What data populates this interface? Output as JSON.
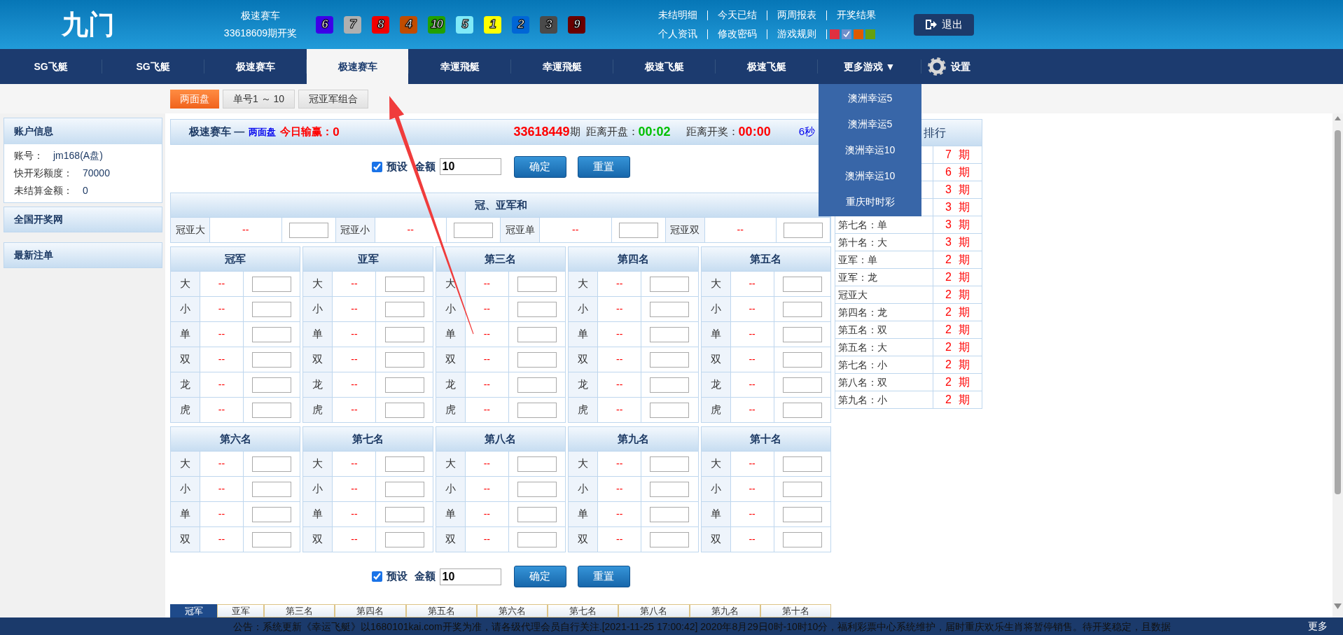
{
  "header": {
    "logo": "九门",
    "game": "极速赛车",
    "draw": "33618609期开奖",
    "balls": [
      {
        "number": "6",
        "color": "#3c00e8"
      },
      {
        "number": "7",
        "color": "#b0b0b0"
      },
      {
        "number": "8",
        "color": "#f00000"
      },
      {
        "number": "4",
        "color": "#c04c00"
      },
      {
        "number": "10",
        "color": "#22a000"
      },
      {
        "number": "5",
        "color": "#80eaf8"
      },
      {
        "number": "1",
        "color": "#ffff00"
      },
      {
        "number": "2",
        "color": "#0066d6"
      },
      {
        "number": "3",
        "color": "#4a4a4a"
      },
      {
        "number": "9",
        "color": "#6a0000"
      }
    ],
    "links_row_1": [
      "未结明细",
      "今天已结",
      "两周报表",
      "开奖结果"
    ],
    "links_row_2": [
      "个人资讯",
      "修改密码",
      "游戏规则"
    ],
    "themes": [
      {
        "color": "#e03040",
        "selected": false
      },
      {
        "color": "#6f8fcc",
        "selected": true
      },
      {
        "color": "#e05a00",
        "selected": false
      },
      {
        "color": "#66a010",
        "selected": false
      }
    ],
    "logout": "退出"
  },
  "nav": {
    "tabs": [
      {
        "label": "SG飞艇",
        "selected": false
      },
      {
        "label": "SG飞艇",
        "selected": false
      },
      {
        "label": "极速赛车",
        "selected": false
      },
      {
        "label": "极速赛车",
        "selected": true
      },
      {
        "label": "幸運飛艇",
        "selected": false
      },
      {
        "label": "幸運飛艇",
        "selected": false
      },
      {
        "label": "极速飞艇",
        "selected": false
      },
      {
        "label": "极速飞艇",
        "selected": false
      }
    ],
    "more": "更多游戏 ▼",
    "settings": "设置",
    "menu": [
      "澳洲幸运5",
      "澳洲幸运5",
      "澳洲幸运10",
      "澳洲幸运10",
      "重庆时时彩"
    ]
  },
  "subtabs": [
    {
      "label": "两面盘",
      "selected": true
    },
    {
      "label": "单号1 ～ 10",
      "selected": false
    },
    {
      "label": "冠亚军组合",
      "selected": false
    }
  ],
  "sidebar": {
    "account_title": "账户信息",
    "account_rows": [
      {
        "label": "账号：",
        "value": "jm168(A盘)"
      },
      {
        "label": "快开彩额度：",
        "value": "70000"
      },
      {
        "label": "未结算金额：",
        "value": "0"
      }
    ],
    "panels": [
      "全国开奖网",
      "最新注单"
    ]
  },
  "bet_header": {
    "game": "极速赛车 —",
    "mode": "两面盘",
    "today_label": "今日输赢：",
    "today_value": "0",
    "period": "33618449",
    "period_suffix": "期",
    "open_label": "距离开盘：",
    "open_time": "00:02",
    "draw_label": "距离开奖：",
    "draw_time": "00:00",
    "refresh": "6秒"
  },
  "presets": [
    {
      "label": "预设",
      "checked": true,
      "amount_label": "金额",
      "amount": "10",
      "confirm": "确定",
      "reset": "重置"
    },
    {
      "label": "预设",
      "checked": true,
      "amount_label": "金额",
      "amount": "10",
      "confirm": "确定",
      "reset": "重置"
    }
  ],
  "sum_section": {
    "title": "冠、亚军和",
    "items": [
      {
        "label": "冠亚大",
        "odds": "--"
      },
      {
        "label": "冠亚小",
        "odds": "--"
      },
      {
        "label": "冠亚单",
        "odds": "--"
      },
      {
        "label": "冠亚双",
        "odds": "--"
      }
    ]
  },
  "grids": [
    {
      "columns": [
        {
          "title": "冠军",
          "rows": [
            {
              "label": "大",
              "odds": "--"
            },
            {
              "label": "小",
              "odds": "--"
            },
            {
              "label": "单",
              "odds": "--"
            },
            {
              "label": "双",
              "odds": "--"
            },
            {
              "label": "龙",
              "odds": "--"
            },
            {
              "label": "虎",
              "odds": "--"
            }
          ]
        },
        {
          "title": "亚军",
          "rows": [
            {
              "label": "大",
              "odds": "--"
            },
            {
              "label": "小",
              "odds": "--"
            },
            {
              "label": "单",
              "odds": "--"
            },
            {
              "label": "双",
              "odds": "--"
            },
            {
              "label": "龙",
              "odds": "--"
            },
            {
              "label": "虎",
              "odds": "--"
            }
          ]
        },
        {
          "title": "第三名",
          "rows": [
            {
              "label": "大",
              "odds": "--"
            },
            {
              "label": "小",
              "odds": "--"
            },
            {
              "label": "单",
              "odds": "--"
            },
            {
              "label": "双",
              "odds": "--"
            },
            {
              "label": "龙",
              "odds": "--"
            },
            {
              "label": "虎",
              "odds": "--"
            }
          ]
        },
        {
          "title": "第四名",
          "rows": [
            {
              "label": "大",
              "odds": "--"
            },
            {
              "label": "小",
              "odds": "--"
            },
            {
              "label": "单",
              "odds": "--"
            },
            {
              "label": "双",
              "odds": "--"
            },
            {
              "label": "龙",
              "odds": "--"
            },
            {
              "label": "虎",
              "odds": "--"
            }
          ]
        },
        {
          "title": "第五名",
          "rows": [
            {
              "label": "大",
              "odds": "--"
            },
            {
              "label": "小",
              "odds": "--"
            },
            {
              "label": "单",
              "odds": "--"
            },
            {
              "label": "双",
              "odds": "--"
            },
            {
              "label": "龙",
              "odds": "--"
            },
            {
              "label": "虎",
              "odds": "--"
            }
          ]
        }
      ]
    },
    {
      "columns": [
        {
          "title": "第六名",
          "rows": [
            {
              "label": "大",
              "odds": "--"
            },
            {
              "label": "小",
              "odds": "--"
            },
            {
              "label": "单",
              "odds": "--"
            },
            {
              "label": "双",
              "odds": "--"
            }
          ]
        },
        {
          "title": "第七名",
          "rows": [
            {
              "label": "大",
              "odds": "--"
            },
            {
              "label": "小",
              "odds": "--"
            },
            {
              "label": "单",
              "odds": "--"
            },
            {
              "label": "双",
              "odds": "--"
            }
          ]
        },
        {
          "title": "第八名",
          "rows": [
            {
              "label": "大",
              "odds": "--"
            },
            {
              "label": "小",
              "odds": "--"
            },
            {
              "label": "单",
              "odds": "--"
            },
            {
              "label": "双",
              "odds": "--"
            }
          ]
        },
        {
          "title": "第九名",
          "rows": [
            {
              "label": "大",
              "odds": "--"
            },
            {
              "label": "小",
              "odds": "--"
            },
            {
              "label": "单",
              "odds": "--"
            },
            {
              "label": "双",
              "odds": "--"
            }
          ]
        },
        {
          "title": "第十名",
          "rows": [
            {
              "label": "大",
              "odds": "--"
            },
            {
              "label": "小",
              "odds": "--"
            },
            {
              "label": "单",
              "odds": "--"
            },
            {
              "label": "双",
              "odds": "--"
            }
          ]
        }
      ]
    }
  ],
  "ranking": {
    "title": "排行",
    "rows": [
      {
        "count": "7",
        "unit": "期"
      },
      {
        "count": "6",
        "unit": "期"
      },
      {
        "count": "3",
        "unit": "期"
      },
      {
        "count": "3",
        "unit": "期"
      },
      {
        "label": "第七名：单",
        "count": "3",
        "unit": "期"
      },
      {
        "label": "第十名：大",
        "count": "3",
        "unit": "期"
      },
      {
        "label": "亚军：单",
        "count": "2",
        "unit": "期"
      },
      {
        "label": "亚军：龙",
        "count": "2",
        "unit": "期"
      },
      {
        "label": "冠亚大",
        "count": "2",
        "unit": "期"
      },
      {
        "label": "第四名：龙",
        "count": "2",
        "unit": "期"
      },
      {
        "label": "第五名：双",
        "count": "2",
        "unit": "期"
      },
      {
        "label": "第五名：大",
        "count": "2",
        "unit": "期"
      },
      {
        "label": "第七名：小",
        "count": "2",
        "unit": "期"
      },
      {
        "label": "第八名：双",
        "count": "2",
        "unit": "期"
      },
      {
        "label": "第九名：小",
        "count": "2",
        "unit": "期"
      }
    ]
  },
  "bottom_tabs": [
    {
      "label": "冠军",
      "selected": true
    },
    {
      "label": "亚军",
      "selected": false
    },
    {
      "label": "第三名",
      "selected": false
    },
    {
      "label": "第四名",
      "selected": false
    },
    {
      "label": "第五名",
      "selected": false
    },
    {
      "label": "第六名",
      "selected": false
    },
    {
      "label": "第七名",
      "selected": false
    },
    {
      "label": "第八名",
      "selected": false
    },
    {
      "label": "第九名",
      "selected": false
    },
    {
      "label": "第十名",
      "selected": false
    }
  ],
  "notice": {
    "text": "公告：系统更新《幸运飞艇》以1680101kai.com开奖为准，请各级代理会员自行关注.[2021-11-25 17:00:42] 2020年8月29日0时-10时10分，福利彩票中心系统维护，届时重庆欢乐生肖将暂停销售。待开奖稳定，且数据",
    "more": "更多"
  }
}
